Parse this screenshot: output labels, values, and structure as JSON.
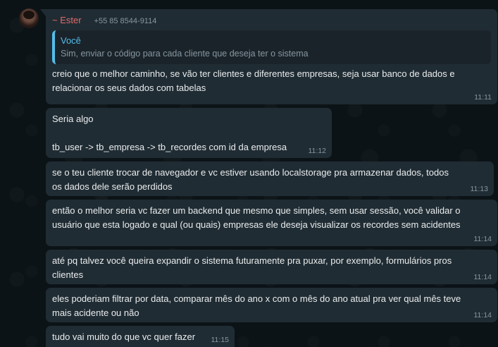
{
  "conversation": {
    "sender": {
      "name": "~ Ester",
      "phone": "+55 85 8544-9114"
    },
    "quote": {
      "author": "Você",
      "text": "Sim, enviar o código para cada cliente que deseja ter o sistema"
    },
    "messages": [
      {
        "text": "creio que o melhor caminho, se vão ter clientes e diferentes empresas, seja usar banco de dados e relacionar os seus dados com tabelas",
        "time": "11:11"
      },
      {
        "text": "Seria algo\n\ntb_user -> tb_empresa -> tb_recordes com id da empresa",
        "time": "11:12"
      },
      {
        "text": "se o teu cliente trocar de navegador e vc estiver usando localstorage pra armazenar dados, todos os dados dele serão perdidos",
        "time": "11:13"
      },
      {
        "text": "então o melhor seria vc fazer um backend que mesmo que simples, sem usar sessão, você validar o usuário que esta logado e qual (ou quais) empresas ele deseja visualizar os recordes sem acidentes",
        "time": "11:14"
      },
      {
        "text": "até pq talvez você queira expandir o sistema futuramente pra puxar, por exemplo, formulários pros clientes",
        "time": "11:14"
      },
      {
        "text": "eles poderiam filtrar por data, comparar mês do ano x com o mês do ano atual pra ver qual mês teve mais acidente ou não",
        "time": "11:14"
      },
      {
        "text": "tudo vai muito do que vc quer fazer",
        "time": "11:15"
      }
    ]
  },
  "colors": {
    "background": "#0b141a",
    "bubble": "#202c33",
    "sender_name": "#e26a6a",
    "quote_accent": "#53bdeb",
    "muted_text": "#8696a0",
    "primary_text": "#e9edef"
  }
}
